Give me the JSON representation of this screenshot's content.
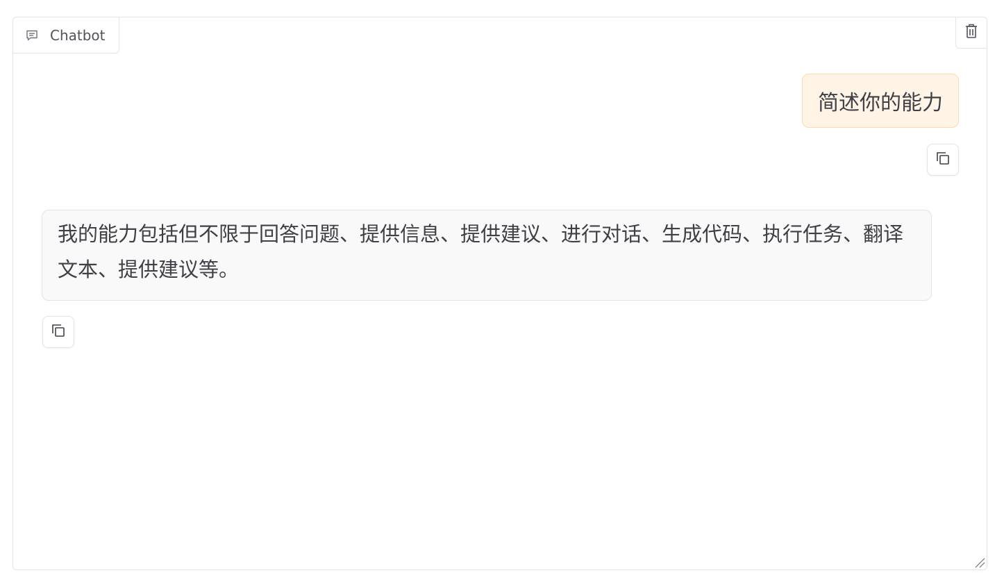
{
  "chatbot": {
    "label": "Chatbot",
    "messages": [
      {
        "role": "user",
        "text": "简述你的能力"
      },
      {
        "role": "bot",
        "text": "我的能力包括但不限于回答问题、提供信息、提供建议、进行对话、生成代码、执行任务、翻译文本、提供建议等。"
      }
    ]
  },
  "icons": {
    "label_icon": "chat-bubble-icon",
    "clear": "trash-icon",
    "copy": "copy-icon",
    "resize": "resize-handle-icon"
  },
  "colors": {
    "user_bubble_bg": "#fff4e6",
    "user_bubble_border": "#fcd9a9",
    "bot_bubble_bg": "#f9f9f9",
    "border": "#e4e4e7",
    "text": "#3f3f46"
  }
}
